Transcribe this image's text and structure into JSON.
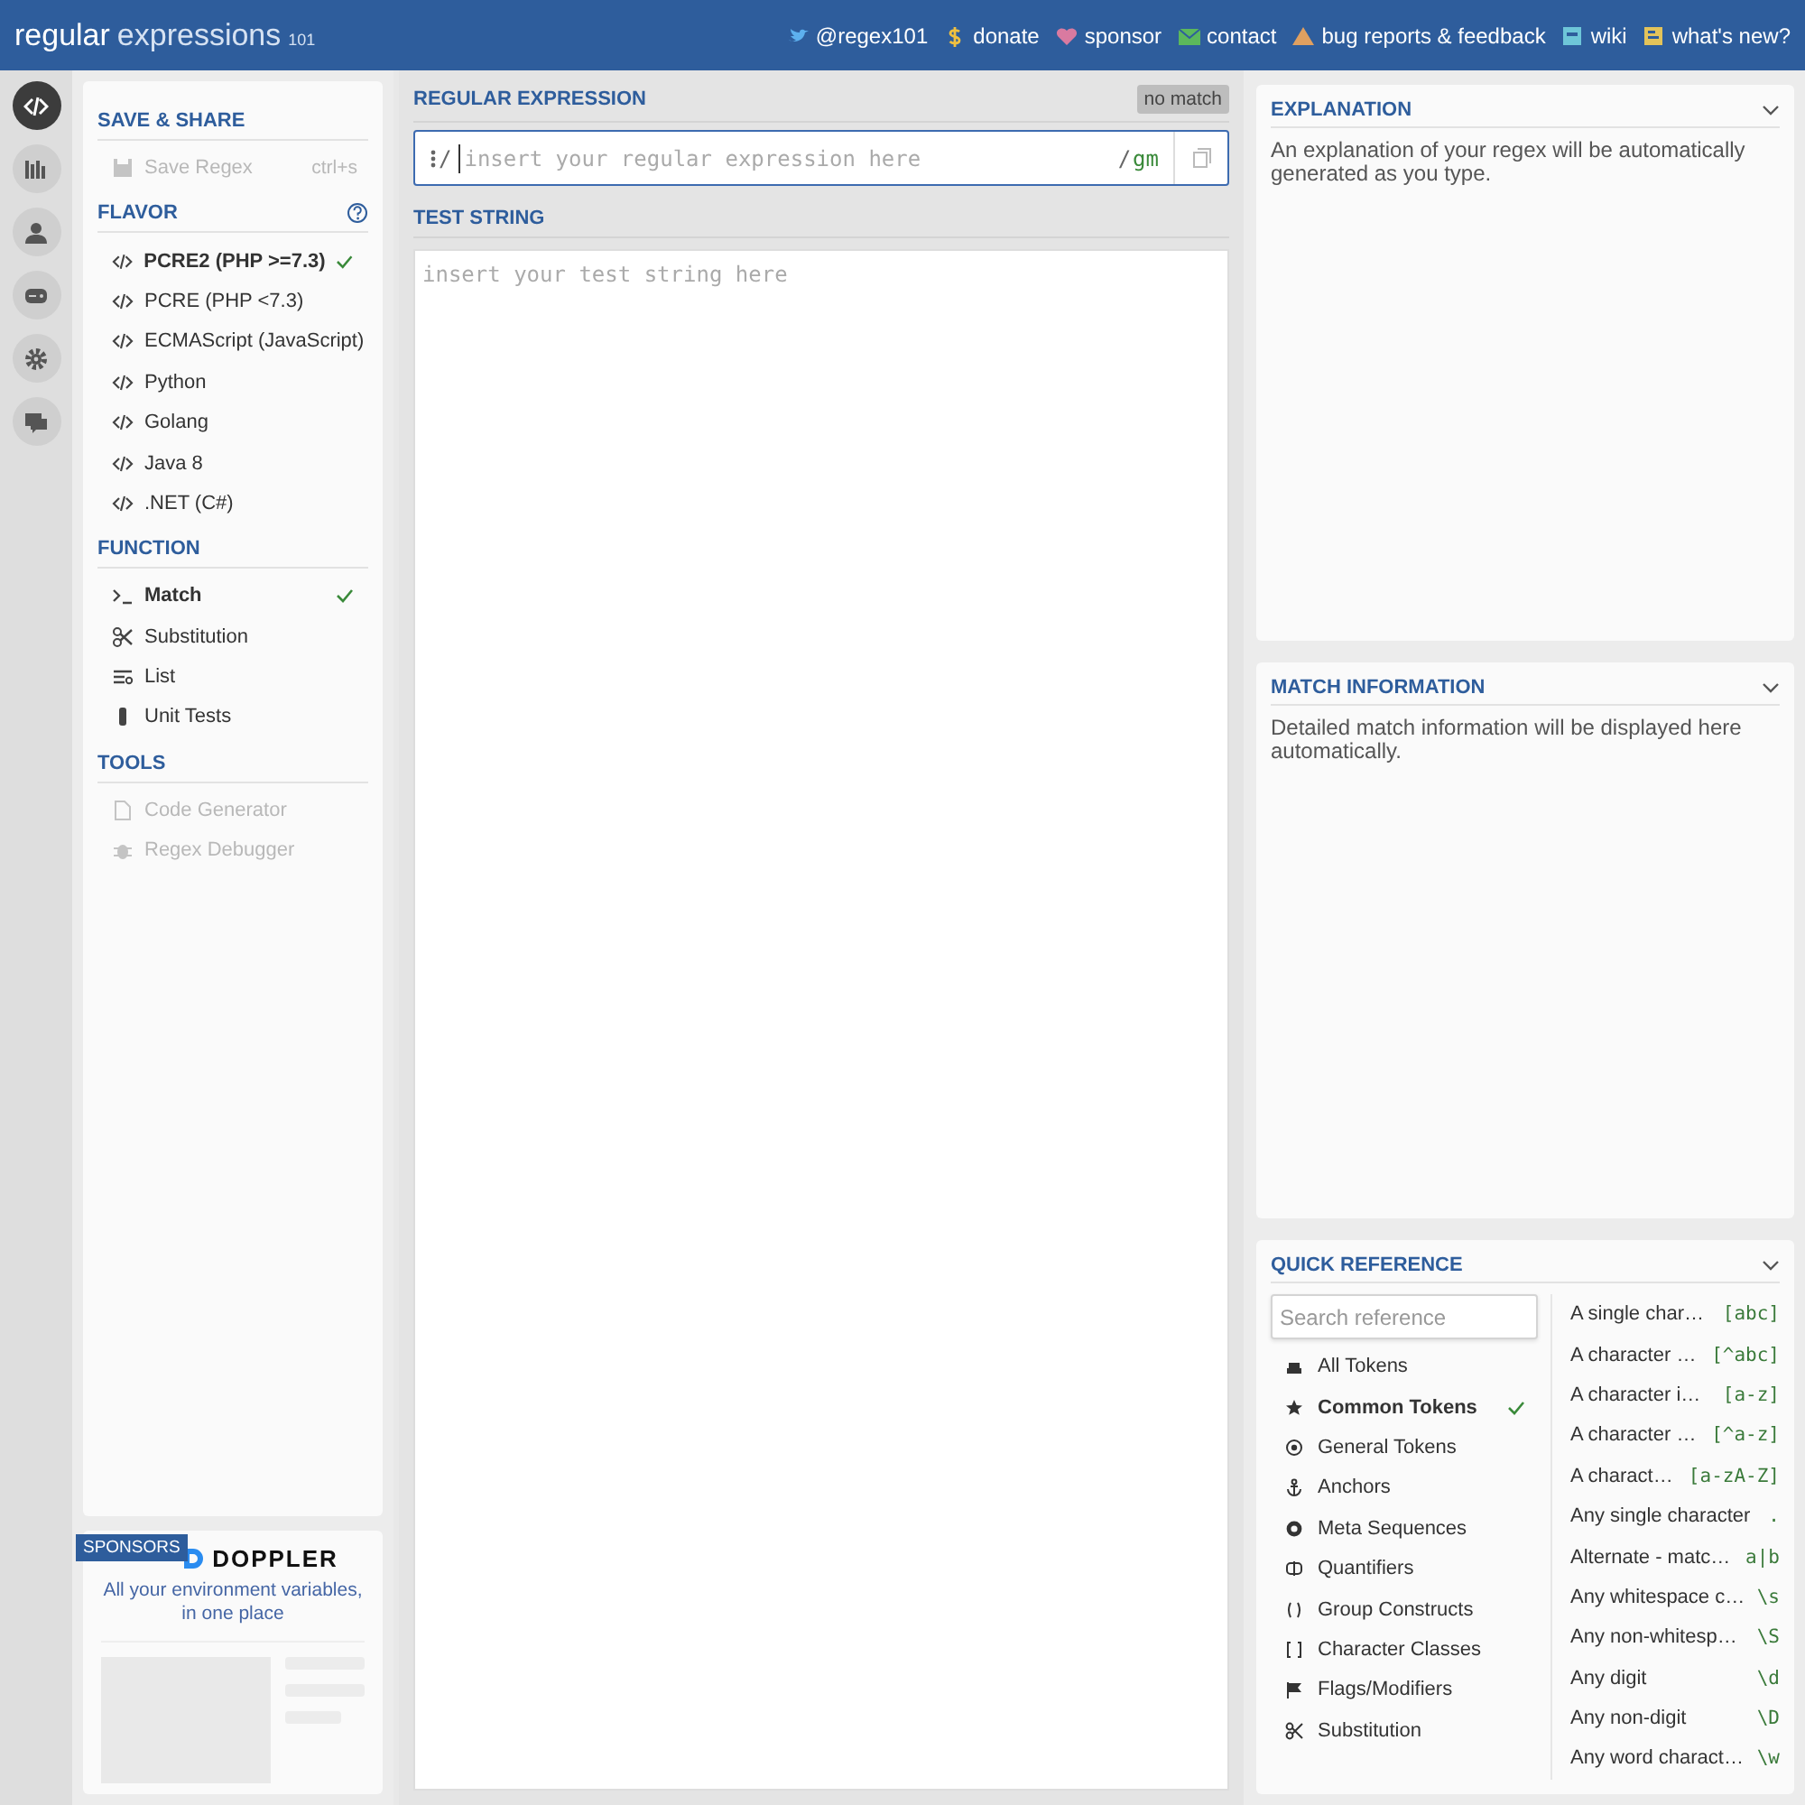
{
  "header": {
    "logo": {
      "main": "regular",
      "rest": "expressions",
      "version": "101"
    },
    "links": [
      {
        "label": "@regex101"
      },
      {
        "label": "donate"
      },
      {
        "label": "sponsor"
      },
      {
        "label": "contact"
      },
      {
        "label": "bug reports & feedback"
      },
      {
        "label": "wiki"
      },
      {
        "label": "what's new?"
      }
    ]
  },
  "rail": [
    {
      "selected": true
    },
    {
      "selected": false
    },
    {
      "selected": false
    },
    {
      "selected": false
    },
    {
      "selected": false
    },
    {
      "selected": false
    }
  ],
  "sidebar": {
    "save_share": {
      "title": "SAVE & SHARE",
      "items": [
        {
          "label": "Save Regex",
          "shortcut": "ctrl+s",
          "disabled": true
        }
      ]
    },
    "flavor": {
      "title": "FLAVOR",
      "items": [
        {
          "label": "PCRE2 (PHP >=7.3)",
          "selected": true
        },
        {
          "label": "PCRE (PHP <7.3)",
          "selected": false
        },
        {
          "label": "ECMAScript (JavaScript)",
          "selected": false
        },
        {
          "label": "Python",
          "selected": false
        },
        {
          "label": "Golang",
          "selected": false
        },
        {
          "label": "Java 8",
          "selected": false
        },
        {
          "label": ".NET (C#)",
          "selected": false
        }
      ]
    },
    "function": {
      "title": "FUNCTION",
      "items": [
        {
          "label": "Match",
          "selected": true
        },
        {
          "label": "Substitution",
          "selected": false
        },
        {
          "label": "List",
          "selected": false
        },
        {
          "label": "Unit Tests",
          "selected": false
        }
      ]
    },
    "tools": {
      "title": "TOOLS",
      "items": [
        {
          "label": "Code Generator",
          "disabled": true
        },
        {
          "label": "Regex Debugger",
          "disabled": true
        }
      ]
    }
  },
  "sponsor": {
    "badge": "SPONSORS",
    "name": "DOPPLER",
    "tagline": "All your environment variables, in one place"
  },
  "regex": {
    "title": "REGULAR EXPRESSION",
    "status": "no match",
    "delimiter_open": "/",
    "placeholder": "insert your regular expression here",
    "delimiter_close": "/",
    "flags": "gm"
  },
  "test_string": {
    "title": "TEST STRING",
    "placeholder": "insert your test string here"
  },
  "explanation": {
    "title": "EXPLANATION",
    "text": "An explanation of your regex will be automatically generated as you type."
  },
  "match_info": {
    "title": "MATCH INFORMATION",
    "text": "Detailed match information will be displayed here automatically."
  },
  "quick_reference": {
    "title": "QUICK REFERENCE",
    "search": {
      "placeholder": "Search reference"
    },
    "categories": [
      {
        "label": "All Tokens",
        "selected": false
      },
      {
        "label": "Common Tokens",
        "selected": true
      },
      {
        "label": "General Tokens",
        "selected": false
      },
      {
        "label": "Anchors",
        "selected": false
      },
      {
        "label": "Meta Sequences",
        "selected": false
      },
      {
        "label": "Quantifiers",
        "selected": false
      },
      {
        "label": "Group Constructs",
        "selected": false
      },
      {
        "label": "Character Classes",
        "selected": false
      },
      {
        "label": "Flags/Modifiers",
        "selected": false
      },
      {
        "label": "Substitution",
        "selected": false
      }
    ],
    "tokens": [
      {
        "description": "A single char…",
        "token": "[abc]"
      },
      {
        "description": "A character …",
        "token": "[^abc]"
      },
      {
        "description": "A character i…",
        "token": "[a-z]"
      },
      {
        "description": "A character …",
        "token": "[^a-z]"
      },
      {
        "description": "A charact…",
        "token": "[a-zA-Z]"
      },
      {
        "description": "Any single character",
        "token": "."
      },
      {
        "description": "Alternate - matc…",
        "token": "a|b"
      },
      {
        "description": "Any whitespace c…",
        "token": "\\s"
      },
      {
        "description": "Any non-whitesp…",
        "token": "\\S"
      },
      {
        "description": "Any digit",
        "token": "\\d"
      },
      {
        "description": "Any non-digit",
        "token": "\\D"
      },
      {
        "description": "Any word charact…",
        "token": "\\w"
      }
    ]
  }
}
